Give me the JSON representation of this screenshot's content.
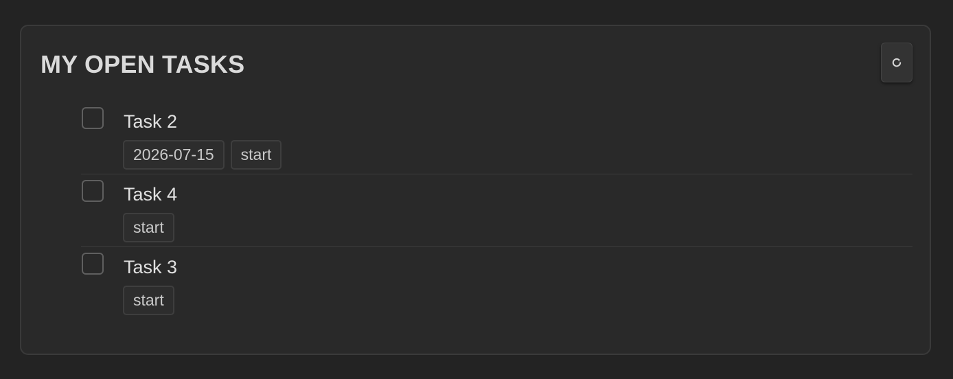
{
  "panel": {
    "title": "MY OPEN TASKS",
    "refresh_icon": "refresh-icon"
  },
  "tasks": [
    {
      "title": "Task 2",
      "checked": false,
      "tags": [
        "2026-07-15",
        "start"
      ]
    },
    {
      "title": "Task 4",
      "checked": false,
      "tags": [
        "start"
      ]
    },
    {
      "title": "Task 3",
      "checked": false,
      "tags": [
        "start"
      ]
    }
  ],
  "colors": {
    "background": "#232323",
    "panel": "#292929",
    "text": "#e0e0e0"
  }
}
